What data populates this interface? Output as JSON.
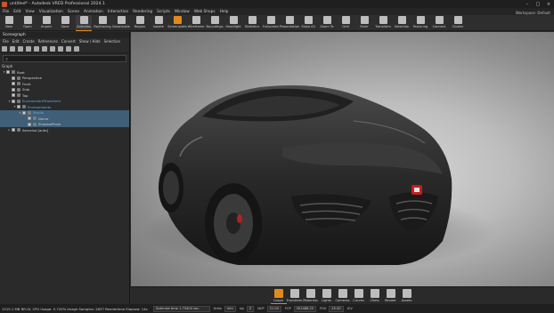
{
  "window": {
    "title": "untitled* - Autodesk VRED Professional 2024.1",
    "controls": [
      "–",
      "□",
      "×"
    ]
  },
  "menu": [
    "File",
    "Edit",
    "View",
    "Visualization",
    "Scene",
    "Animation",
    "Interaction",
    "Rendering",
    "Scripts",
    "Window",
    "Web Shops",
    "Help"
  ],
  "toolbar": [
    {
      "label": "New",
      "icon": "new-file-icon"
    },
    {
      "label": "Open",
      "icon": "open-folder-icon"
    },
    {
      "label": "Import",
      "icon": "import-icon"
    },
    {
      "label": "Save",
      "icon": "save-icon"
    },
    {
      "label": "Antialias",
      "icon": "antialias-icon",
      "active": true
    },
    {
      "label": "Raytracing",
      "icon": "raytracing-icon"
    },
    {
      "label": "Downscale",
      "icon": "downscale-icon"
    },
    {
      "label": "Region",
      "icon": "region-icon"
    },
    {
      "label": "Isolate",
      "icon": "isolate-icon"
    },
    {
      "label": "Screenplate",
      "icon": "screenplate-icon",
      "orange": true
    },
    {
      "label": "Wireframe",
      "icon": "wireframe-icon"
    },
    {
      "label": "Boundings",
      "icon": "boundings-icon"
    },
    {
      "label": "Headlight",
      "icon": "headlight-icon"
    },
    {
      "label": "Statistics",
      "icon": "statistics-icon"
    },
    {
      "label": "Fullscreen",
      "icon": "fullscreen-icon"
    },
    {
      "label": "Presentation",
      "icon": "presentation-icon"
    },
    {
      "label": "Show All",
      "icon": "show-all-icon"
    },
    {
      "label": "Zoom To",
      "icon": "zoom-to-icon"
    },
    {
      "label": "Grid",
      "icon": "grid-icon"
    },
    {
      "label": "Ruler",
      "icon": "ruler-icon"
    },
    {
      "label": "Transform",
      "icon": "transform-icon"
    },
    {
      "label": "Selection",
      "icon": "selection-icon"
    },
    {
      "label": "Texturing",
      "icon": "texturing-icon"
    },
    {
      "label": "Connect",
      "icon": "connect-icon"
    },
    {
      "label": "Cluster",
      "icon": "cluster-icon"
    }
  ],
  "workspace": "Workspace: Default",
  "scenegraph": {
    "title": "Scenegraph",
    "menu": [
      "File",
      "Edit",
      "Create",
      "References",
      "Convert",
      "Show / Hide",
      "Selection"
    ],
    "search_placeholder": "",
    "header": "Graph",
    "rows": [
      {
        "indent": 0,
        "arrow": "▾",
        "name": "Root",
        "checked": true,
        "blue": false,
        "selected": false
      },
      {
        "indent": 1,
        "arrow": "",
        "name": "Perspective",
        "checked": true,
        "blue": false,
        "selected": false
      },
      {
        "indent": 1,
        "arrow": "",
        "name": "Front",
        "checked": true,
        "blue": false,
        "selected": false
      },
      {
        "indent": 1,
        "arrow": "",
        "name": "Side",
        "checked": true,
        "blue": false,
        "selected": false
      },
      {
        "indent": 1,
        "arrow": "",
        "name": "Top",
        "checked": true,
        "blue": false,
        "selected": false
      },
      {
        "indent": 1,
        "arrow": "▾",
        "name": "EnvironmentTransform",
        "checked": true,
        "blue": true,
        "selected": false
      },
      {
        "indent": 2,
        "arrow": "▾",
        "name": "Environments",
        "checked": true,
        "blue": true,
        "selected": false
      },
      {
        "indent": 3,
        "arrow": "▾",
        "name": "Studio",
        "checked": true,
        "blue": true,
        "selected": true
      },
      {
        "indent": 4,
        "arrow": "",
        "name": "Dome",
        "checked": true,
        "blue": false,
        "selected": true
      },
      {
        "indent": 4,
        "arrow": "",
        "name": "ShadowPlane",
        "checked": true,
        "blue": false,
        "selected": true
      },
      {
        "indent": 1,
        "arrow": "▸",
        "name": "Aerovisa [auto]",
        "checked": true,
        "blue": false,
        "selected": false
      }
    ]
  },
  "dock": [
    {
      "label": "Graph",
      "icon": "graph-icon",
      "active": true
    },
    {
      "label": "Transform",
      "icon": "transform-icon"
    },
    {
      "label": "Materials",
      "icon": "materials-icon"
    },
    {
      "label": "Lights",
      "icon": "lights-icon"
    },
    {
      "label": "Cameras",
      "icon": "cameras-icon"
    },
    {
      "label": "Curves",
      "icon": "curves-icon"
    },
    {
      "label": "VSets",
      "icon": "vsets-icon"
    },
    {
      "label": "Render",
      "icon": "render-icon"
    },
    {
      "label": "Assets",
      "icon": "assets-icon"
    }
  ],
  "status": {
    "info": "1515.1 MB  RR-GL  CPU Usage: 5.720%  Image Samples: 2637  Rendertime Elapsed: 14s",
    "console": "Optimize time 1.75404 sec.",
    "units_label": "Units",
    "units": "mm",
    "up_label": "Up",
    "up": "Z",
    "ncp_label": "NCP",
    "ncp": "21.00",
    "fcp_label": "FCP",
    "fcp": "301488.25",
    "fov_label": "FOV",
    "fov": "45.00",
    "ice_label": "ICV"
  },
  "colors": {
    "accent": "#e08a1e",
    "selection": "#3f5f78",
    "link": "#5fb2e8"
  }
}
